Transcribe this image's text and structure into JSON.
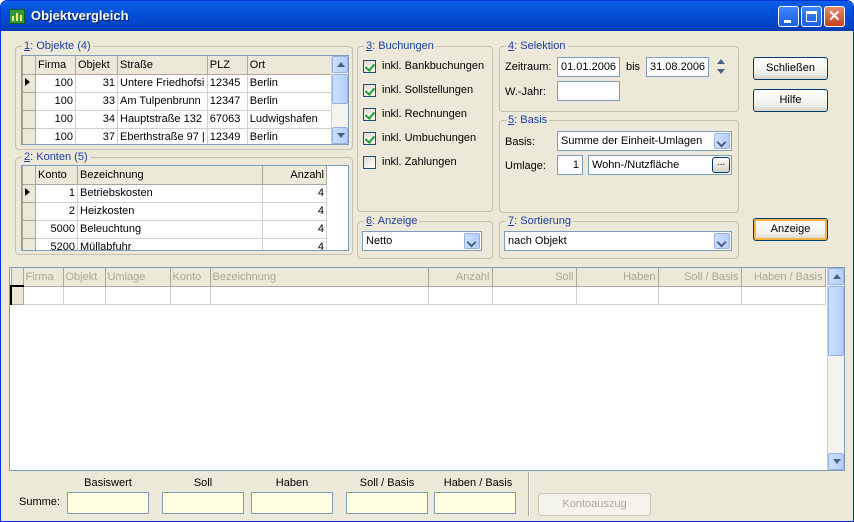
{
  "window": {
    "title": "Objektvergleich"
  },
  "objekte": {
    "num": "1",
    "caption": ": Objekte (4)",
    "columns": [
      "Firma",
      "Objekt",
      "Straße",
      "PLZ",
      "Ort"
    ],
    "rows": [
      [
        "100",
        "31",
        "Untere Friedhofsi",
        "12345",
        "Berlin"
      ],
      [
        "100",
        "33",
        "Am Tulpenbrunn",
        "12347",
        "Berlin"
      ],
      [
        "100",
        "34",
        "Hauptstraße 132",
        "67063",
        "Ludwigshafen"
      ],
      [
        "100",
        "37",
        "Eberthstraße 97 |",
        "12349",
        "Berlin"
      ]
    ]
  },
  "konten": {
    "num": "2",
    "caption": ": Konten (5)",
    "columns": [
      "Konto",
      "Bezeichnung",
      "Anzahl"
    ],
    "rows": [
      [
        "1",
        "Betriebskosten",
        "4"
      ],
      [
        "2",
        "Heizkosten",
        "4"
      ],
      [
        "5000",
        "Beleuchtung",
        "4"
      ],
      [
        "5200",
        "Müllabfuhr",
        "4"
      ]
    ]
  },
  "buchungen": {
    "num": "3",
    "caption": ": Buchungen",
    "items": [
      {
        "label": "inkl. Bankbuchungen",
        "checked": true
      },
      {
        "label": "inkl. Sollstellungen",
        "checked": true
      },
      {
        "label": "inkl. Rechnungen",
        "checked": true
      },
      {
        "label": "inkl. Umbuchungen",
        "checked": true
      },
      {
        "label": "inkl. Zahlungen",
        "checked": false
      }
    ]
  },
  "selektion": {
    "num": "4",
    "caption": ": Selektion",
    "zeitraum_label": "Zeitraum:",
    "from": "01.01.2006",
    "bis_label": "bis",
    "to": "31.08.2006",
    "wjahr_label": "W.-Jahr:",
    "wjahr": ""
  },
  "basis": {
    "num": "5",
    "caption": ": Basis",
    "basis_label": "Basis:",
    "basis_value": "Summe der Einheit-Umlagen",
    "umlage_label": "Umlage:",
    "umlage_num": "1",
    "umlage_value": "Wohn-/Nutzfläche",
    "ellipsis": "..."
  },
  "anzeige": {
    "num": "6",
    "caption": ": Anzeige",
    "value": "Netto"
  },
  "sortierung": {
    "num": "7",
    "caption": ": Sortierung",
    "value": "nach Objekt"
  },
  "buttons": {
    "close": "Schließen",
    "help": "Hilfe",
    "show": "Anzeige",
    "konto": "Kontoauszug"
  },
  "result": {
    "columns": [
      "Firma",
      "Objekt",
      "Umlage",
      "Konto",
      "Bezeichnung",
      "Anzahl",
      "Soll",
      "Haben",
      "Soll / Basis",
      "Haben / Basis"
    ]
  },
  "summary": {
    "label": "Summe:",
    "headers": [
      "Basiswert",
      "Soll",
      "Haben",
      "Soll / Basis",
      "Haben / Basis"
    ]
  }
}
